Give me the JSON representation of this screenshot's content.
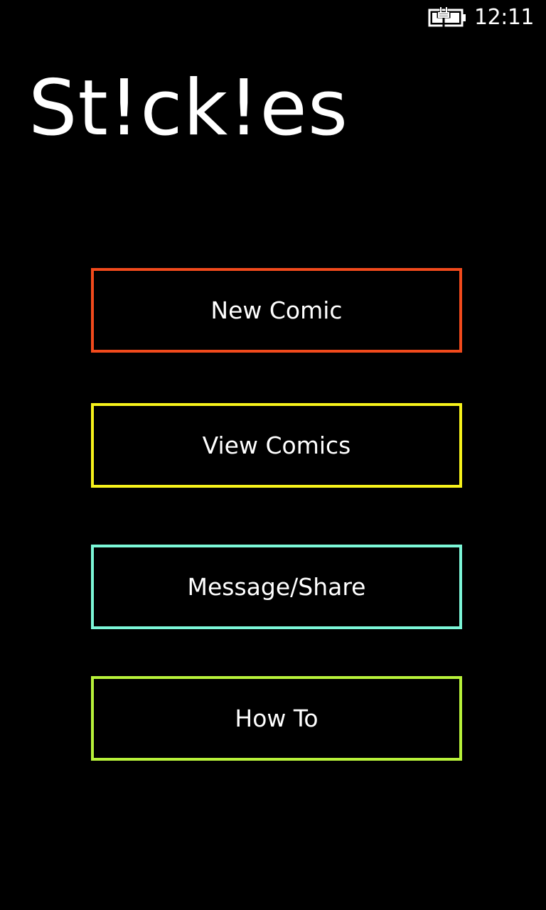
{
  "status_bar": {
    "time": "12:11",
    "battery_icon": "battery-charging-icon"
  },
  "app": {
    "title": "St!ck!es"
  },
  "menu": {
    "items": [
      {
        "label": "New Comic",
        "color": "#f24a1c"
      },
      {
        "label": "View Comics",
        "color": "#f7f21b"
      },
      {
        "label": "Message/Share",
        "color": "#7cf7d8"
      },
      {
        "label": "How To",
        "color": "#b8f23a"
      }
    ]
  }
}
